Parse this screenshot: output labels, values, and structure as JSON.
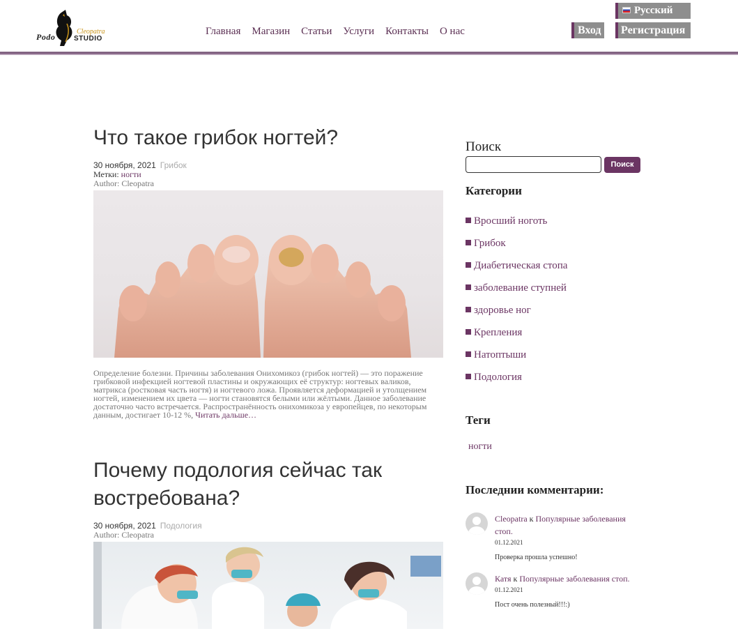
{
  "header": {
    "logo": {
      "text_podo": "Podo",
      "text_studio": "STUDIO",
      "text_cleopatra": "Cleopatra"
    },
    "nav": [
      "Главная",
      "Магазин",
      "Статьи",
      "Услуги",
      "Контакты",
      "О нас"
    ],
    "language": "Русский",
    "login": "Вход",
    "register": "Регистрация",
    "colors": {
      "accent": "#6b3563",
      "button_gray": "#8e8e8e"
    }
  },
  "posts": [
    {
      "title": "Что такое грибок ногтей?",
      "date": "30 ноября, 2021",
      "category": "Грибок",
      "tags_label": "Метки:",
      "tag": "ногти",
      "author": "Author: Cleopatra",
      "excerpt": "Определение болезни. Причины заболевания Онихомикоз (грибок ногтей) — это поражение грибковой инфекцией ногтевой пластины и окружающих её структур: ногтевых валиков, матрикса (ростковая часть ногтя) и ногтевого ложа. Проявляется деформацией и утолщением ногтей, изменением их цвета — ногти становятся белыми или жёлтыми. Данное заболевание достаточно часто встречается. Распространённость онихомикоза у европейцев, по некоторым данным, достигает 10-12 %,",
      "read_more": "Читать дальше…"
    },
    {
      "title": "Почему подология сейчас так востребована?",
      "date": "30 ноября, 2021",
      "category": "Подология",
      "author": "Author: Cleopatra"
    }
  ],
  "sidebar": {
    "search_title": "Поиск",
    "search_placeholder": "",
    "search_button": "Поиск",
    "categories_title": "Категории",
    "categories": [
      "Вросший ноготь",
      "Грибок",
      "Диабетическая стопа",
      "заболевание ступней",
      "здоровье ног",
      "Крепления",
      "Натоптыши",
      "Подология"
    ],
    "tags_title": "Теги",
    "tags": [
      "ногти"
    ],
    "comments_title": "Последнии комментарии:",
    "comments": [
      {
        "author": "Cleopatra",
        "on": "к",
        "post": "Популярные заболевания стоп.",
        "date": "01.12.2021",
        "text": "Проверка прошла успешно!"
      },
      {
        "author": "Катя",
        "on": "к",
        "post": "Популярные заболевания стоп.",
        "date": "01.12.2021",
        "text": "Пост очень полезный!!!:)"
      }
    ]
  }
}
